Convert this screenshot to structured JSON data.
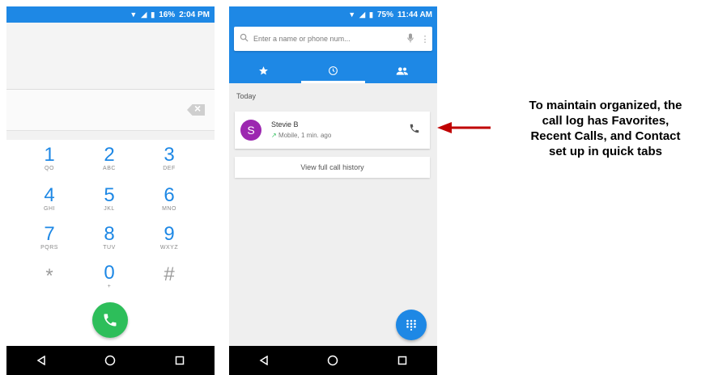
{
  "dialer": {
    "status": {
      "battery_pct": "16%",
      "time": "2:04 PM"
    },
    "keys": [
      {
        "digit": "1",
        "letters": "QO"
      },
      {
        "digit": "2",
        "letters": "ABC"
      },
      {
        "digit": "3",
        "letters": "DEF"
      },
      {
        "digit": "4",
        "letters": "GHI"
      },
      {
        "digit": "5",
        "letters": "JKL"
      },
      {
        "digit": "6",
        "letters": "MNO"
      },
      {
        "digit": "7",
        "letters": "PQRS"
      },
      {
        "digit": "8",
        "letters": "TUV"
      },
      {
        "digit": "9",
        "letters": "WXYZ"
      },
      {
        "digit": "*",
        "letters": ""
      },
      {
        "digit": "0",
        "letters": "+"
      },
      {
        "digit": "#",
        "letters": ""
      }
    ],
    "colors": {
      "accent": "#1e88e5",
      "call": "#2dbe5a"
    }
  },
  "call_log": {
    "status": {
      "battery_pct": "75%",
      "time": "11:44 AM"
    },
    "search_placeholder": "Enter a name or phone num...",
    "tabs": [
      {
        "icon": "star-icon",
        "active": false
      },
      {
        "icon": "clock-icon",
        "active": true
      },
      {
        "icon": "contacts-icon",
        "active": false
      }
    ],
    "section_label": "Today",
    "entries": [
      {
        "avatar_letter": "S",
        "name": "Stevie B",
        "detail": "Mobile, 1 min. ago",
        "avatar_color": "#9c27b0"
      }
    ],
    "history_button": "View full call history"
  },
  "annotation": {
    "lines": [
      "To maintain organized, the",
      "call log has Favorites,",
      "Recent Calls, and Contact",
      "set up in quick tabs"
    ],
    "arrow_color": "#c00000"
  }
}
